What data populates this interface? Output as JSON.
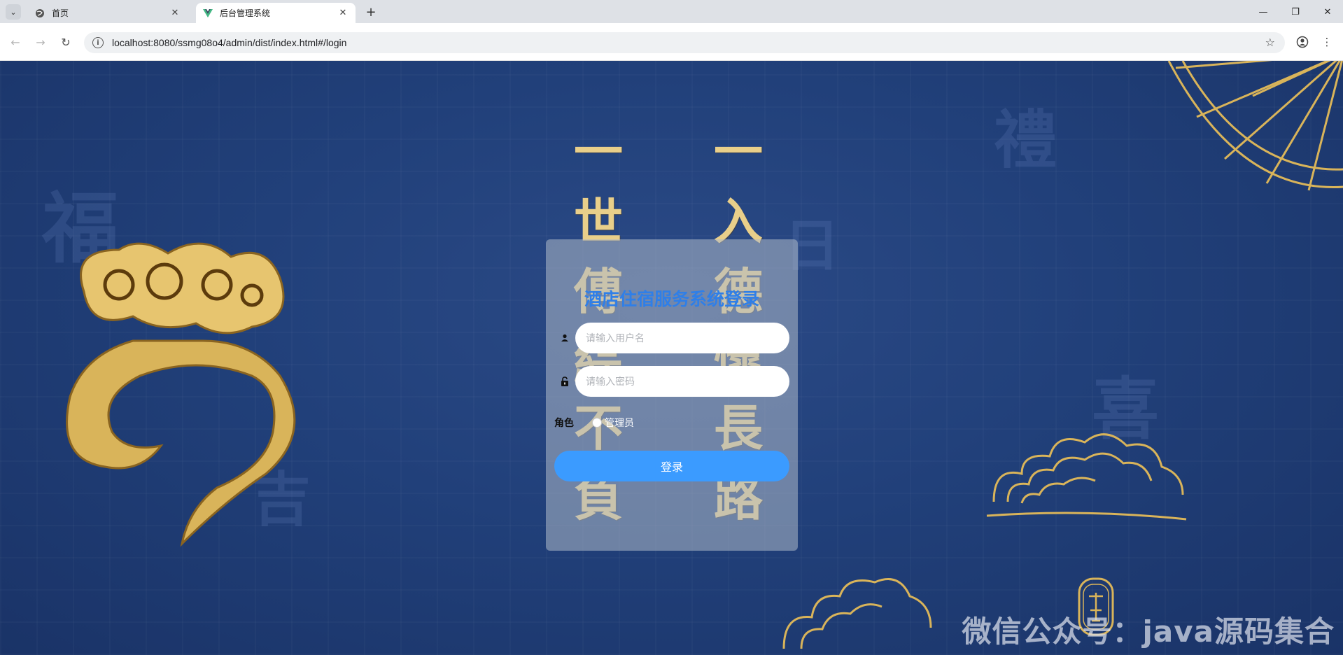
{
  "browser": {
    "tabs": [
      {
        "title": "首页",
        "active": false
      },
      {
        "title": "后台管理系统",
        "active": true
      }
    ],
    "url": "localhost:8080/ssmg08o4/admin/dist/index.html#/login"
  },
  "background": {
    "calligraphy_left": [
      "一",
      "世",
      "傅",
      "綜",
      "不",
      "負"
    ],
    "calligraphy_right": [
      "一",
      "入",
      "德",
      "懷",
      "長",
      "路"
    ],
    "watermark": "微信公众号：java源码集合"
  },
  "login": {
    "title": "酒店住宿服务系统登录",
    "username_placeholder": "请输入用户名",
    "password_placeholder": "请输入密码",
    "role_label": "角色",
    "role_options": [
      "管理员"
    ],
    "submit_label": "登录"
  },
  "colors": {
    "title": "#2f7fe8",
    "button": "#3b9bff",
    "gold": "#e9cf8a",
    "background": "#21407a"
  },
  "icons": {
    "username": "user-icon",
    "password": "lock-icon",
    "tab_home": "globe-icon",
    "tab_admin": "vue-logo-icon"
  }
}
